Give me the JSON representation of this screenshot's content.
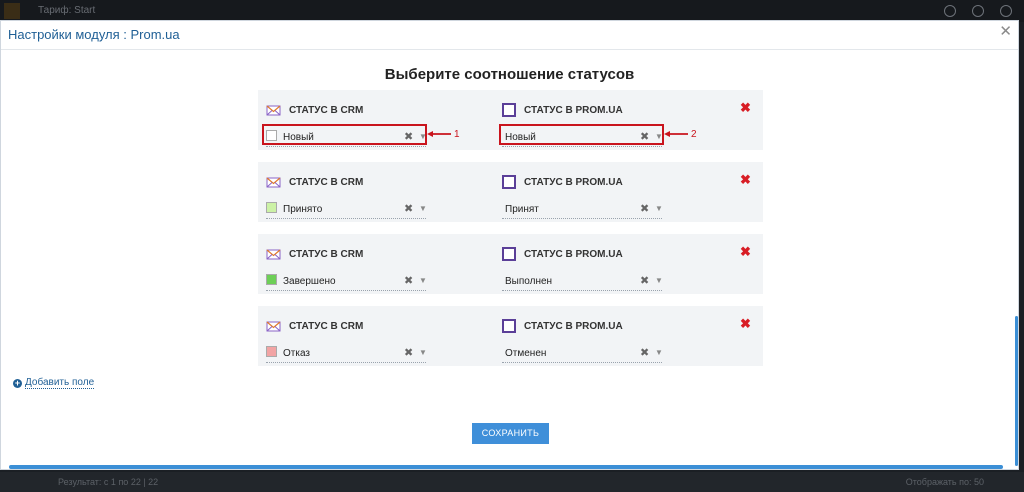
{
  "modal": {
    "title": "Настройки модуля : Prom.ua",
    "close_label": "✕",
    "heading": "Выберите соотношение статусов",
    "crm_header": "СТАТУС В CRM",
    "prom_header": "СТАТУС В PROM.UA",
    "clear_symbol": "✖",
    "arrow_symbol": "▼",
    "delete_symbol": "✖",
    "rows": [
      {
        "crm_status": "Новый",
        "crm_color": "#ffffff",
        "prom_status": "Новый"
      },
      {
        "crm_status": "Принято",
        "crm_color": "#ccf2a6",
        "prom_status": "Принят"
      },
      {
        "crm_status": "Завершено",
        "crm_color": "#6dcf57",
        "prom_status": "Выполнен"
      },
      {
        "crm_status": "Отказ",
        "crm_color": "#f2a4a4",
        "prom_status": "Отменен"
      }
    ],
    "annotations": {
      "marker_1": "1",
      "marker_2": "2"
    },
    "add_field_label": "Добавить поле",
    "save_label": "СОХРАНИТЬ"
  },
  "background": {
    "top_text": "Тариф: Start",
    "bottom_left": "Результат: с 1 по 22 | 22",
    "bottom_right": "Отображать по: 50"
  },
  "colors": {
    "accent": "#3f8fd9",
    "title": "#1f5f95",
    "highlight": "#c9141d",
    "prom_icon": "#5b3f98"
  }
}
